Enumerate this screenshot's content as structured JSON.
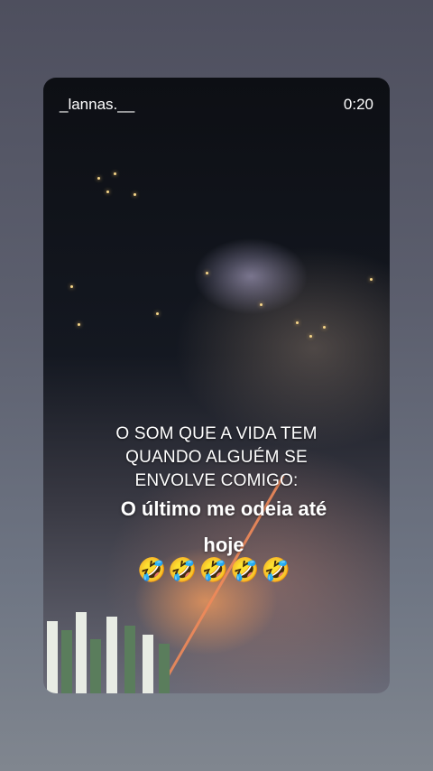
{
  "story": {
    "username": "_lannas.__",
    "timer": "0:20",
    "caption_lines": [
      "O SOM QUE A VIDA TEM",
      "QUANDO ALGUÉM SE",
      "ENVOLVE COMIGO:"
    ],
    "overlay_lines": [
      "O último me odeia até",
      "hoje"
    ],
    "emojis": "🤣🤣🤣🤣🤣"
  }
}
